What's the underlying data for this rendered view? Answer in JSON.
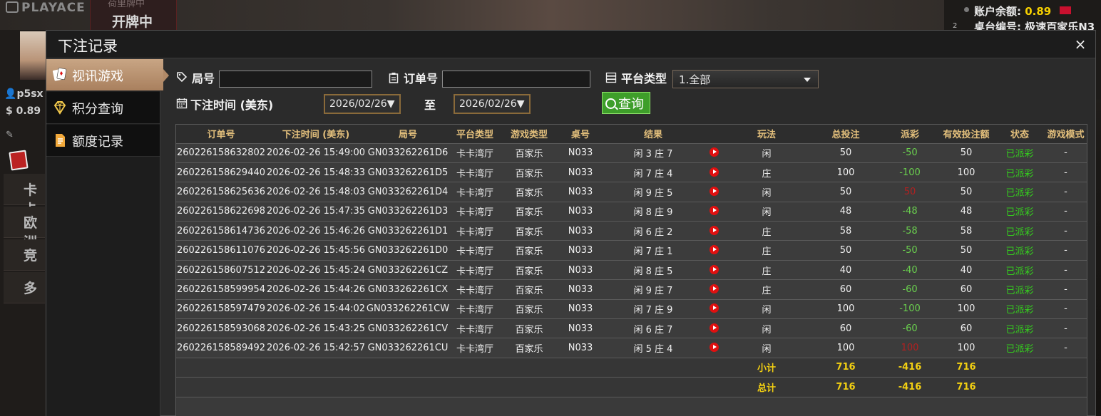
{
  "background": {
    "logo": "PLAYACE",
    "dealing_small": "荷里牌中",
    "dealing": "开牌中",
    "username": "p5sx",
    "balance_short": "0.89",
    "side_items": [
      "卡卡",
      "欧洲厅",
      "竞",
      "多"
    ],
    "account_balance_label": "账户余额:",
    "account_balance_value": "0.89",
    "table_label": "桌台编号:",
    "table_value": "极速百家乐N3"
  },
  "dialog": {
    "title": "下注记录",
    "close_label": "×"
  },
  "sidebar": {
    "items": [
      {
        "label": "视讯游戏",
        "icon": "playing-cards-icon"
      },
      {
        "label": "积分查询",
        "icon": "diamond-icon"
      },
      {
        "label": "额度记录",
        "icon": "document-icon"
      }
    ]
  },
  "filters": {
    "round_label": "局号",
    "round_value": "",
    "order_label": "订单号",
    "order_value": "",
    "platform_label": "平台类型",
    "platform_value": "1.全部",
    "time_label": "下注时间 (美东)",
    "date_from": "2026/02/26",
    "date_sep": "至",
    "date_to": "2026/02/26",
    "date_caret": "▼",
    "query_label": "查询"
  },
  "table": {
    "headers": [
      "订单号",
      "下注时间 (美东)",
      "局号",
      "平台类型",
      "游戏类型",
      "桌号",
      "结果",
      "",
      "玩法",
      "总投注",
      "派彩",
      "有效投注额",
      "状态",
      "游戏模式"
    ],
    "rows": [
      [
        "260226158632802",
        "2026-02-26 15:49:00",
        "GN033262261D6",
        "卡卡湾厅",
        "百家乐",
        "N033",
        "闲 3 庄 7",
        "闲",
        "50",
        "-50",
        "50",
        "已派彩",
        "-"
      ],
      [
        "260226158629440",
        "2026-02-26 15:48:33",
        "GN033262261D5",
        "卡卡湾厅",
        "百家乐",
        "N033",
        "闲 7 庄 4",
        "庄",
        "100",
        "-100",
        "100",
        "已派彩",
        "-"
      ],
      [
        "260226158625636",
        "2026-02-26 15:48:03",
        "GN033262261D4",
        "卡卡湾厅",
        "百家乐",
        "N033",
        "闲 9 庄 5",
        "闲",
        "50",
        "50",
        "50",
        "已派彩",
        "-"
      ],
      [
        "260226158622698",
        "2026-02-26 15:47:35",
        "GN033262261D3",
        "卡卡湾厅",
        "百家乐",
        "N033",
        "闲 8 庄 9",
        "闲",
        "48",
        "-48",
        "48",
        "已派彩",
        "-"
      ],
      [
        "260226158614736",
        "2026-02-26 15:46:26",
        "GN033262261D1",
        "卡卡湾厅",
        "百家乐",
        "N033",
        "闲 6 庄 2",
        "庄",
        "58",
        "-58",
        "58",
        "已派彩",
        "-"
      ],
      [
        "260226158611076",
        "2026-02-26 15:45:56",
        "GN033262261D0",
        "卡卡湾厅",
        "百家乐",
        "N033",
        "闲 7 庄 1",
        "庄",
        "50",
        "-50",
        "50",
        "已派彩",
        "-"
      ],
      [
        "260226158607512",
        "2026-02-26 15:45:24",
        "GN033262261CZ",
        "卡卡湾厅",
        "百家乐",
        "N033",
        "闲 8 庄 5",
        "庄",
        "40",
        "-40",
        "40",
        "已派彩",
        "-"
      ],
      [
        "260226158599954",
        "2026-02-26 15:44:26",
        "GN033262261CX",
        "卡卡湾厅",
        "百家乐",
        "N033",
        "闲 9 庄 7",
        "庄",
        "60",
        "-60",
        "60",
        "已派彩",
        "-"
      ],
      [
        "260226158597479",
        "2026-02-26 15:44:02",
        "GN033262261CW",
        "卡卡湾厅",
        "百家乐",
        "N033",
        "闲 7 庄 9",
        "闲",
        "100",
        "-100",
        "100",
        "已派彩",
        "-"
      ],
      [
        "260226158593068",
        "2026-02-26 15:43:25",
        "GN033262261CV",
        "卡卡湾厅",
        "百家乐",
        "N033",
        "闲 6 庄 7",
        "闲",
        "60",
        "-60",
        "60",
        "已派彩",
        "-"
      ],
      [
        "260226158589492",
        "2026-02-26 15:42:57",
        "GN033262261CU",
        "卡卡湾厅",
        "百家乐",
        "N033",
        "闲 5 庄 4",
        "闲",
        "100",
        "100",
        "100",
        "已派彩",
        "-"
      ]
    ],
    "subtotal": {
      "label": "小计",
      "total_bet": "716",
      "payout": "-416",
      "valid_bet": "716"
    },
    "total": {
      "label": "总计",
      "total_bet": "716",
      "payout": "-416",
      "valid_bet": "716"
    }
  },
  "colors": {
    "header_gold": "#e4c07c",
    "negative_green": "#6ad04e",
    "positive_red": "#b32020",
    "status_green": "#35cc1e",
    "sum_yellow": "#f3d012",
    "query_green": "#3e9e2a",
    "active_tab": "#b18a68"
  }
}
